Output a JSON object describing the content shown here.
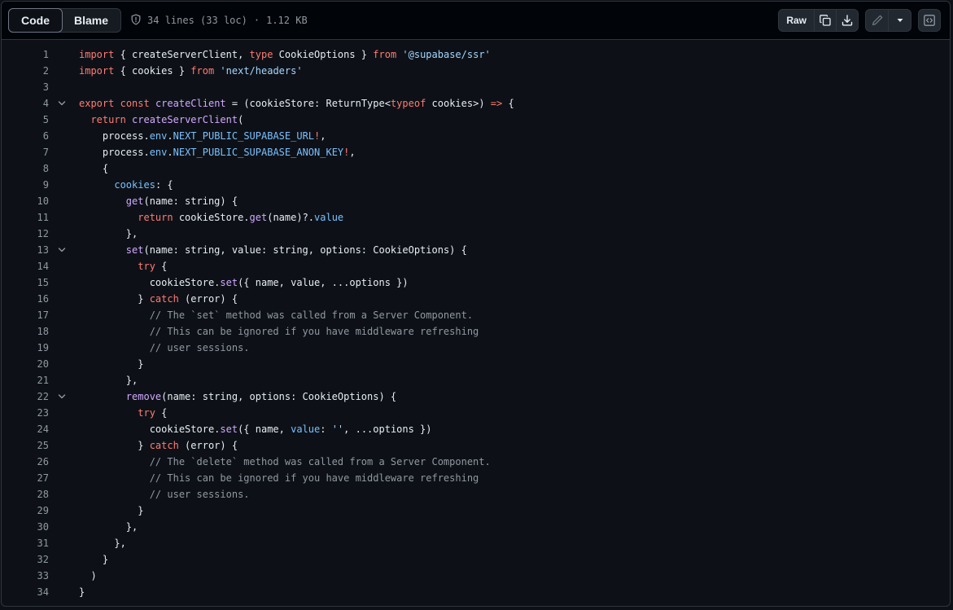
{
  "toolbar": {
    "tabs": [
      "Code",
      "Blame"
    ],
    "active_tab": "Code",
    "lines_info": "34 lines (33 loc)",
    "separator": "·",
    "size": "1.12 KB",
    "raw_label": "Raw",
    "icons": [
      "shield-icon",
      "copy-icon",
      "download-icon",
      "pencil-icon",
      "triangle-down-icon",
      "code-square-icon"
    ]
  },
  "colors": {
    "keyword": "#ff7b72",
    "string": "#a5d6ff",
    "function": "#d2a8ff",
    "comment": "#9198a1",
    "constant": "#79c0ff",
    "property": "#7ee787",
    "text": "#e6edf3"
  },
  "code": {
    "fold_lines": [
      4,
      13,
      22
    ],
    "lines": [
      [
        [
          "k",
          "import"
        ],
        [
          "d",
          " { createServerClient, "
        ],
        [
          "k",
          "type"
        ],
        [
          "d",
          " CookieOptions } "
        ],
        [
          "k",
          "from"
        ],
        [
          "d",
          " "
        ],
        [
          "s",
          "'@supabase/ssr'"
        ]
      ],
      [
        [
          "k",
          "import"
        ],
        [
          "d",
          " { cookies } "
        ],
        [
          "k",
          "from"
        ],
        [
          "d",
          " "
        ],
        [
          "s",
          "'next/headers'"
        ]
      ],
      [],
      [
        [
          "k",
          "export"
        ],
        [
          "d",
          " "
        ],
        [
          "k",
          "const"
        ],
        [
          "d",
          " "
        ],
        [
          "f",
          "createClient"
        ],
        [
          "d",
          " = (cookieStore: ReturnType<"
        ],
        [
          "k",
          "typeof"
        ],
        [
          "d",
          " cookies>) "
        ],
        [
          "k",
          "=>"
        ],
        [
          "d",
          " {"
        ]
      ],
      [
        [
          "d",
          "  "
        ],
        [
          "k",
          "return"
        ],
        [
          "d",
          " "
        ],
        [
          "f",
          "createServerClient"
        ],
        [
          "d",
          "("
        ]
      ],
      [
        [
          "d",
          "    process."
        ],
        [
          "v",
          "env"
        ],
        [
          "d",
          "."
        ],
        [
          "v",
          "NEXT_PUBLIC_SUPABASE_URL"
        ],
        [
          "k",
          "!"
        ],
        [
          "d",
          ","
        ]
      ],
      [
        [
          "d",
          "    process."
        ],
        [
          "v",
          "env"
        ],
        [
          "d",
          "."
        ],
        [
          "v",
          "NEXT_PUBLIC_SUPABASE_ANON_KEY"
        ],
        [
          "k",
          "!"
        ],
        [
          "d",
          ","
        ]
      ],
      [
        [
          "d",
          "    {"
        ]
      ],
      [
        [
          "d",
          "      "
        ],
        [
          "v",
          "cookies"
        ],
        [
          "d",
          ": {"
        ]
      ],
      [
        [
          "d",
          "        "
        ],
        [
          "f",
          "get"
        ],
        [
          "d",
          "(name: string) {"
        ]
      ],
      [
        [
          "d",
          "          "
        ],
        [
          "k",
          "return"
        ],
        [
          "d",
          " cookieStore."
        ],
        [
          "f",
          "get"
        ],
        [
          "d",
          "(name)?."
        ],
        [
          "v",
          "value"
        ]
      ],
      [
        [
          "d",
          "        },"
        ]
      ],
      [
        [
          "d",
          "        "
        ],
        [
          "f",
          "set"
        ],
        [
          "d",
          "(name: string, value: string, options: CookieOptions) {"
        ]
      ],
      [
        [
          "d",
          "          "
        ],
        [
          "k",
          "try"
        ],
        [
          "d",
          " {"
        ]
      ],
      [
        [
          "d",
          "            cookieStore."
        ],
        [
          "f",
          "set"
        ],
        [
          "d",
          "({ name, value, ...options })"
        ]
      ],
      [
        [
          "d",
          "          } "
        ],
        [
          "k",
          "catch"
        ],
        [
          "d",
          " (error) {"
        ]
      ],
      [
        [
          "d",
          "            "
        ],
        [
          "c",
          "// The `set` method was called from a Server Component."
        ]
      ],
      [
        [
          "d",
          "            "
        ],
        [
          "c",
          "// This can be ignored if you have middleware refreshing"
        ]
      ],
      [
        [
          "d",
          "            "
        ],
        [
          "c",
          "// user sessions."
        ]
      ],
      [
        [
          "d",
          "          }"
        ]
      ],
      [
        [
          "d",
          "        },"
        ]
      ],
      [
        [
          "d",
          "        "
        ],
        [
          "f",
          "remove"
        ],
        [
          "d",
          "(name: string, options: CookieOptions) {"
        ]
      ],
      [
        [
          "d",
          "          "
        ],
        [
          "k",
          "try"
        ],
        [
          "d",
          " {"
        ]
      ],
      [
        [
          "d",
          "            cookieStore."
        ],
        [
          "f",
          "set"
        ],
        [
          "d",
          "({ name, "
        ],
        [
          "v",
          "value"
        ],
        [
          "d",
          ": "
        ],
        [
          "s",
          "''"
        ],
        [
          "d",
          ", ...options })"
        ]
      ],
      [
        [
          "d",
          "          } "
        ],
        [
          "k",
          "catch"
        ],
        [
          "d",
          " (error) {"
        ]
      ],
      [
        [
          "d",
          "            "
        ],
        [
          "c",
          "// The `delete` method was called from a Server Component."
        ]
      ],
      [
        [
          "d",
          "            "
        ],
        [
          "c",
          "// This can be ignored if you have middleware refreshing"
        ]
      ],
      [
        [
          "d",
          "            "
        ],
        [
          "c",
          "// user sessions."
        ]
      ],
      [
        [
          "d",
          "          }"
        ]
      ],
      [
        [
          "d",
          "        },"
        ]
      ],
      [
        [
          "d",
          "      },"
        ]
      ],
      [
        [
          "d",
          "    }"
        ]
      ],
      [
        [
          "d",
          "  )"
        ]
      ],
      [
        [
          "d",
          "}"
        ]
      ]
    ]
  }
}
